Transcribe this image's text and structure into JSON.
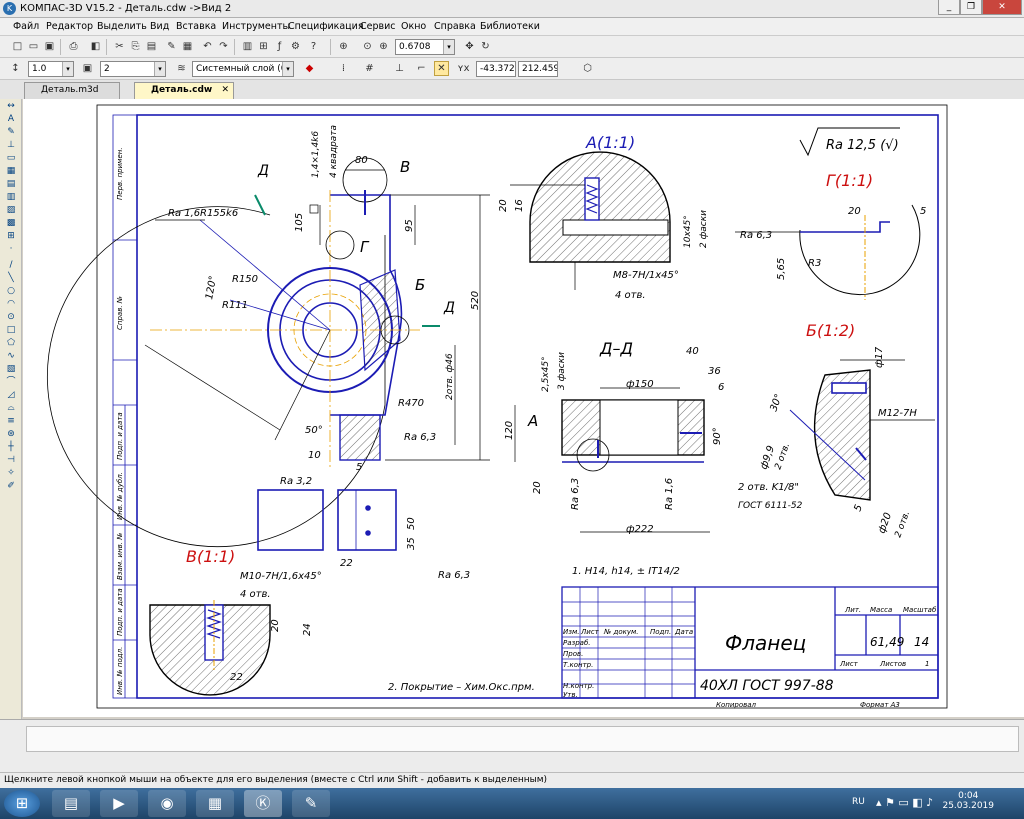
{
  "app": {
    "title": "КОМПАС-3D V15.2  - Деталь.cdw ->Вид 2",
    "logo_letter": "K"
  },
  "window_buttons": {
    "minimize": "_",
    "restore": "❐",
    "close": "✕"
  },
  "menu": [
    "Файл",
    "Редактор",
    "Выделить",
    "Вид",
    "Вставка",
    "Инструменты",
    "Спецификация",
    "Сервис",
    "Окно",
    "Справка",
    "Библиотеки"
  ],
  "toolbar1": {
    "zoom": "0.6708"
  },
  "toolbar2": {
    "scale": "1.0",
    "style": "2",
    "layer": "Системный слой (0)",
    "coord_x": "-43.3723",
    "coord_y": "212.4595"
  },
  "tabs": [
    {
      "label": "Деталь.m3d"
    },
    {
      "label": "Деталь.cdw"
    }
  ],
  "drawing": {
    "views": {
      "a": "А(1:1)",
      "b": "Б(1:2)",
      "v": "В(1:1)",
      "g": "Г(1:1)",
      "dd": "Д–Д",
      "d_marker": "Д",
      "b_marker": "Б",
      "v_marker": "В",
      "g_marker": "Г",
      "a_marker": "А"
    },
    "roughness": {
      "main": "Ra 12,5 (√)",
      "r1": "Ra 1,6",
      "r2": "Ra 6,3",
      "r3": "Ra 3,2",
      "r4": "Ra 6,3",
      "r5": "Ra 6,3",
      "r6": "Ra 6,3",
      "r7": "Ra 1,6",
      "r8": "Ra 6,3"
    },
    "dims": {
      "d80": "80",
      "d95": "95",
      "d105": "105",
      "d520": "520",
      "d120": "120",
      "d50deg": "50°",
      "d10": "10",
      "d5": "5",
      "r155": "R155k6",
      "r150": "R150",
      "r111": "R111",
      "r470": "R470",
      "d120deg": "120°",
      "holes46": "2отв. ф46",
      "sq": "4 квадрата",
      "sq2": "1,4×1,4k6",
      "a20": "20",
      "a16": "16",
      "a_thr": "M8-7H/1x45°",
      "a_holes": "4 отв.",
      "a_cham": "2 фаски",
      "a_10": "10x45°",
      "g20": "20",
      "g5": "5",
      "g565": "5,65",
      "gr3": "R3",
      "dd40": "40",
      "dd36": "36",
      "dd6": "6",
      "dd150": "ф150",
      "dd222": "ф222",
      "dd120": "120",
      "dd20": "20",
      "dd_cham": "2,5x45°",
      "dd_cham2": "3 фаски",
      "dd90": "90°",
      "b17": "ф17",
      "b30": "30°",
      "b_thr": "M12-7H",
      "b99": "ф9,9",
      "b_holes": "2 отв.",
      "b_k": "2 отв. K1/8\"",
      "b_gost": "ГОСТ 6111-52",
      "b20": "ф20",
      "b_2": "2 отв.",
      "b5": "5",
      "v_thr": "M10-7H/1,6x45°",
      "v_holes": "4 отв.",
      "v20": "20",
      "v24": "24",
      "v22": "22",
      "s50": "50",
      "s35": "35",
      "s22": "22"
    },
    "notes": {
      "n1": "1. H14, h14, ± IT14/2",
      "n2": "2. Покрытие – Хим.Окс.прм."
    },
    "title_block": {
      "name": "Фланец",
      "material": "40ХЛ ГОСТ 997-88",
      "lit_label": "Лит.",
      "mass_label": "Масса",
      "scale_label": "Масштаб",
      "mass": "61,49",
      "scale": "14",
      "sheet_label": "Лист",
      "sheets_label": "Листов",
      "sheets": "1",
      "copied": "Копировал",
      "format": "Формат   А3",
      "h_izm": "Изм.",
      "h_list": "Лист",
      "h_doc": "№ докум.",
      "h_sign": "Подп.",
      "h_date": "Дата",
      "r_razrab": "Разраб.",
      "r_prov": "Пров.",
      "r_tkontr": "Т.контр.",
      "r_nkontr": "Н.контр.",
      "r_utv": "Утв."
    },
    "side_block": [
      "Перв. примен.",
      "Справ. №",
      "Подп. и дата",
      "Инв. № дубл.",
      "Взам. инв. №",
      "Подп. и дата",
      "Инв. № подл."
    ]
  },
  "status": "Щелкните левой кнопкой мыши на объекте для его выделения (вместе с Ctrl или Shift - добавить к выделенным)",
  "taskbar": {
    "lang": "RU",
    "time": "0:04",
    "date": "25.03.2019"
  },
  "colors": {
    "blue": "#1c1cb4",
    "red": "#cc1010",
    "accent_orange": "#e8a000"
  }
}
